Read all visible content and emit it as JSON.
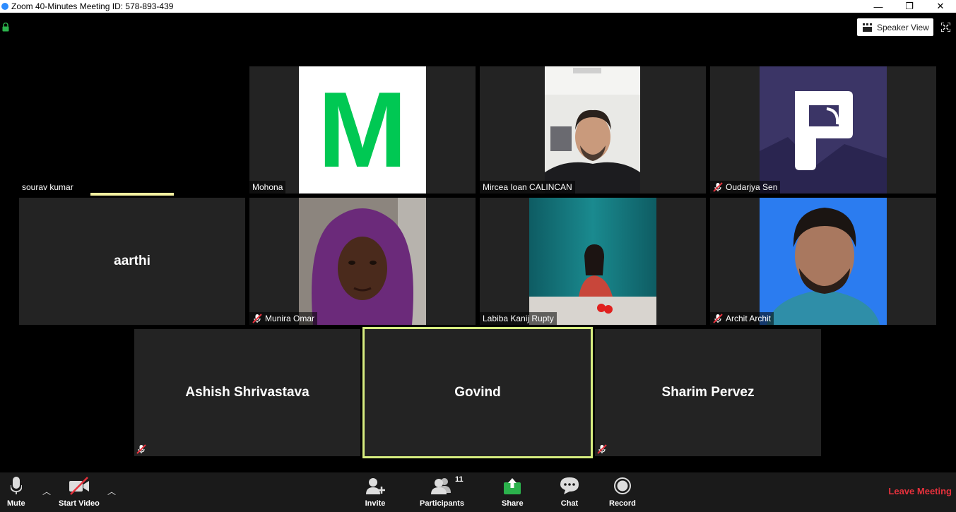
{
  "window": {
    "title": "Zoom 40-Minutes Meeting ID: 578-893-439",
    "minimize": "—",
    "restore": "❐",
    "close": "✕"
  },
  "top": {
    "speaker_view_label": "Speaker View"
  },
  "tiles": {
    "sourav": "sourav kumar",
    "mohona": "Mohona",
    "mohona_avatar_letter": "M",
    "mircea": "Mircea Ioan CALINCAN",
    "oudarjya": "Oudarjya Sen",
    "aarthi": "aarthi",
    "munira": "Munira Omar",
    "labiba": "Labiba Kanij Rupty",
    "archit": "Archit Archit",
    "ashish": "Ashish Shrivastava",
    "govind": "Govind",
    "sharim": "Sharim Pervez"
  },
  "toolbar": {
    "mute": "Mute",
    "start_video": "Start Video",
    "invite": "Invite",
    "participants": "Participants",
    "participants_count": "11",
    "share": "Share",
    "chat": "Chat",
    "record": "Record",
    "leave": "Leave Meeting"
  },
  "colors": {
    "active_speaker_border": "#d6ec7f",
    "leave_red": "#e6313c",
    "share_green": "#2bb24c",
    "mohona_green": "#00c853"
  }
}
